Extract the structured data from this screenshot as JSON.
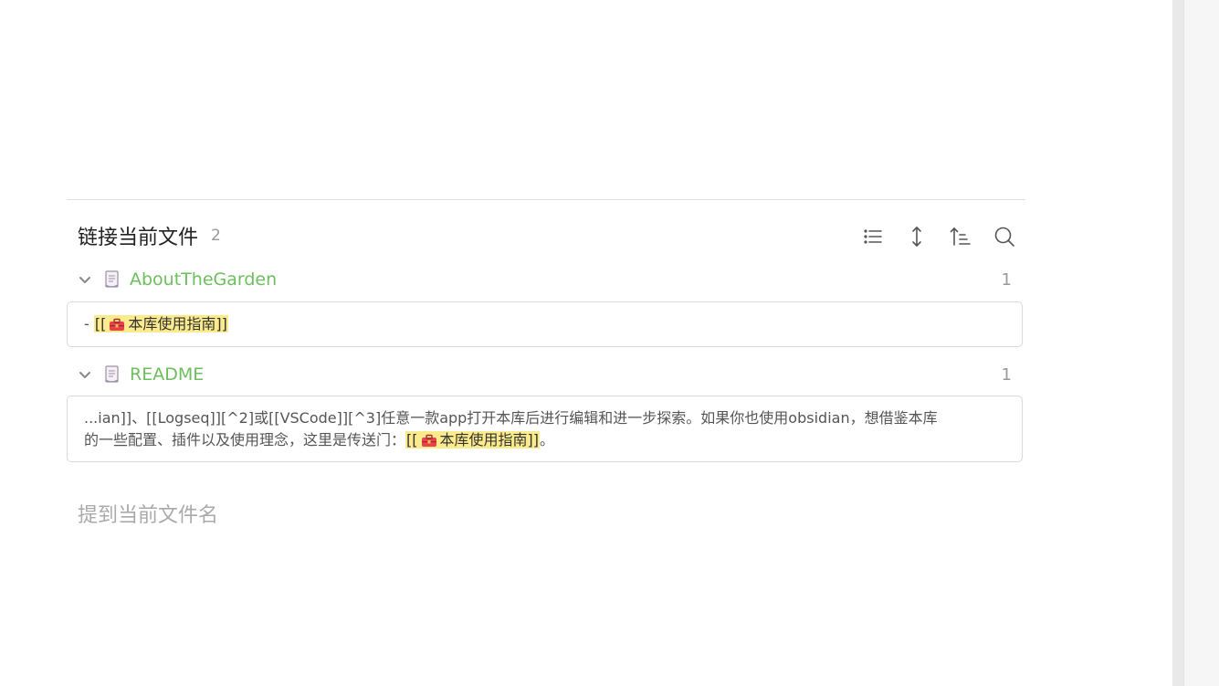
{
  "backlinks": {
    "title": "链接当前文件",
    "count": "2",
    "toolbar": [
      {
        "name": "list-icon"
      },
      {
        "name": "expand-icon"
      },
      {
        "name": "sort-icon"
      },
      {
        "name": "search-icon"
      }
    ],
    "files": [
      {
        "name": "AboutTheGarden",
        "count": "1",
        "snippet": {
          "prefix": "- ",
          "link_open": "[[",
          "link_text": "本库使用指南",
          "link_close": "]]"
        }
      },
      {
        "name": "README",
        "count": "1",
        "snippet": {
          "line1": "...ian]]、[[Logseq]][^2]或[[VSCode]][^3]任意一款app打开本库后进行编辑和进一步探索。如果你也使用obsidian，想借鉴本库",
          "line2_prefix": "的一些配置、插件以及使用理念，这里是传送门：",
          "link_open": "[[",
          "link_text": "本库使用指南",
          "link_close": "]]",
          "suffix": "。"
        }
      }
    ]
  },
  "mentions": {
    "title": "提到当前文件名"
  },
  "colors": {
    "file_name": "#6cbf5c",
    "highlight": "#fbeb8c",
    "toolbox_icon": "#e8414a"
  }
}
